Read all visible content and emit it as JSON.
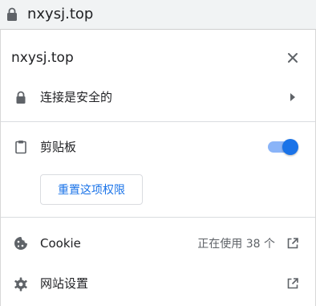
{
  "address_bar": {
    "url": "nxysj.top",
    "icon": "lock-icon"
  },
  "bubble": {
    "title": "nxysj.top",
    "close_icon": "close-icon",
    "connection": {
      "label": "连接是安全的",
      "icon": "lock-icon",
      "chevron": "chevron-right-icon"
    },
    "clipboard": {
      "label": "剪贴板",
      "icon": "clipboard-icon",
      "enabled": true
    },
    "reset_button": {
      "label": "重置这项权限"
    },
    "cookie": {
      "label": "Cookie",
      "status": "正在使用 38 个",
      "icon": "cookie-icon",
      "link_icon": "external-link-icon"
    },
    "site_settings": {
      "label": "网站设置",
      "icon": "gear-icon",
      "link_icon": "external-link-icon"
    }
  },
  "colors": {
    "accent": "#1a73e8",
    "toggle_track": "#8ab4f8",
    "text_primary": "#202124",
    "text_secondary": "#5f6368",
    "divider": "#dadce0",
    "address_bar_bg": "#f1f3f4"
  }
}
